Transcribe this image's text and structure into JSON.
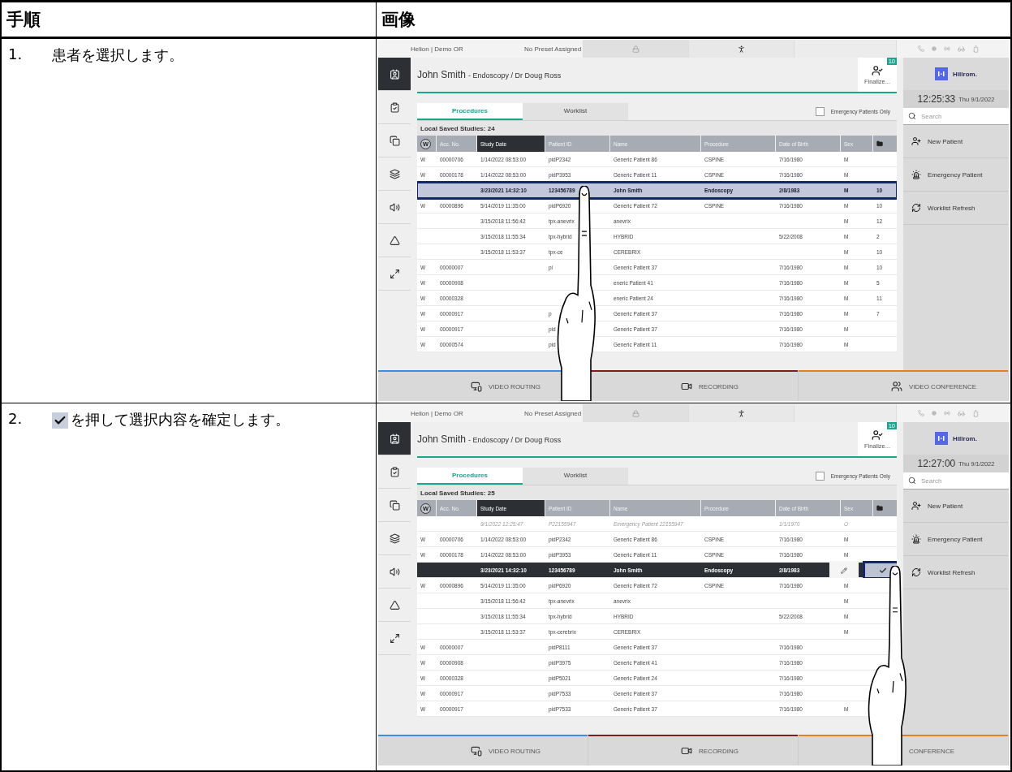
{
  "table_header": {
    "step": "手順",
    "image": "画像"
  },
  "steps": [
    {
      "number": "1.",
      "text": "患者を選択します。",
      "inline_icon": false,
      "screen": {
        "top_bar": {
          "location": "Helion | Demo OR",
          "preset": "No Preset Assigned"
        },
        "rail": [
          {
            "selected": true
          },
          {
            "selected": false
          },
          {
            "selected": false
          },
          {
            "selected": false
          },
          {
            "selected": false
          },
          {
            "selected": false
          },
          {
            "selected": false
          }
        ],
        "header": {
          "patient": "John Smith",
          "details": "- Endoscopy / Dr Doug Ross",
          "finalize_label": "Finalize...",
          "finalize_badge": "10"
        },
        "tabs": [
          {
            "label": "Procedures",
            "selected": true
          },
          {
            "label": "Worklist",
            "selected": false
          }
        ],
        "emergency_filter": {
          "label": "Emergency Patients Only",
          "checked": false
        },
        "saved_studies": "Local Saved Studies: 24",
        "columns": [
          {
            "kind": "circle",
            "label": "W",
            "selected": false
          },
          {
            "kind": "text",
            "label": "Acc. No.",
            "selected": false
          },
          {
            "kind": "text",
            "label": "Study Date",
            "selected": true
          },
          {
            "kind": "text",
            "label": "Patient ID",
            "selected": false
          },
          {
            "kind": "text",
            "label": "Name",
            "selected": false
          },
          {
            "kind": "text",
            "label": "Procedure",
            "selected": false
          },
          {
            "kind": "text",
            "label": "Date of Birth",
            "selected": false
          },
          {
            "kind": "text",
            "label": "Sex",
            "selected": false
          },
          {
            "kind": "icon",
            "selected": false
          }
        ],
        "rows": [
          {
            "kind": "normal",
            "selected": false,
            "w": "W",
            "acc_no": "00000706",
            "study_date": "1/14/2022 08:53:00",
            "patient_id": "pidP2342",
            "name": "Generic Patient 86",
            "procedure": "CSPINE",
            "date_of_birth": "7/16/1980",
            "sex": "M"
          },
          {
            "kind": "normal",
            "selected": false,
            "w": "W",
            "acc_no": "00000178",
            "study_date": "1/14/2022 08:53:00",
            "patient_id": "pidP3953",
            "name": "Generic Patient 11",
            "procedure": "CSPINE",
            "date_of_birth": "7/16/1980",
            "sex": "M"
          },
          {
            "kind": "normal",
            "selected": true,
            "study_date": "3/23/2021 14:32:10",
            "patient_id": "123456789",
            "name": "John Smith",
            "procedure": "Endoscopy",
            "date_of_birth": "2/8/1983",
            "sex": "M",
            "count": "10"
          },
          {
            "kind": "normal",
            "selected": false,
            "w": "W",
            "acc_no": "00000896",
            "study_date": "5/14/2019 11:35:00",
            "patient_id": "pidP6920",
            "name": "Generic Patient 72",
            "procedure": "CSPINE",
            "date_of_birth": "7/16/1980",
            "sex": "M",
            "count": "10"
          },
          {
            "kind": "normal",
            "selected": false,
            "study_date": "3/15/2018 11:56:42",
            "patient_id": "tpx-anevrix",
            "name": "anevrix",
            "sex": "M",
            "count": "12"
          },
          {
            "kind": "normal",
            "selected": false,
            "study_date": "3/15/2018 11:55:34",
            "patient_id": "tpx-hybrid",
            "name": "HYBRID",
            "date_of_birth": "5/22/2008",
            "sex": "M",
            "count": "2"
          },
          {
            "kind": "normal",
            "selected": false,
            "study_date": "3/15/2018 11:53:37",
            "patient_id": "tpx-ce",
            "name": "CEREBRIX",
            "sex": "M",
            "count": "10"
          },
          {
            "kind": "normal",
            "selected": false,
            "w": "W",
            "acc_no": "00000007",
            "patient_id": "pi",
            "name": "Generic Patient 37",
            "date_of_birth": "7/16/1980",
            "sex": "M",
            "count": "10"
          },
          {
            "kind": "normal",
            "selected": false,
            "w": "W",
            "acc_no": "00000908",
            "name": "eneric Patient 41",
            "date_of_birth": "7/16/1980",
            "sex": "M",
            "count": "5"
          },
          {
            "kind": "normal",
            "selected": false,
            "w": "W",
            "acc_no": "00000328",
            "name": "eneric Patient 24",
            "date_of_birth": "7/16/1980",
            "sex": "M",
            "count": "11"
          },
          {
            "kind": "normal",
            "selected": false,
            "w": "W",
            "acc_no": "00000917",
            "patient_id": "p",
            "name": "Generic Patient 37",
            "date_of_birth": "7/16/1980",
            "sex": "M",
            "count": "7"
          },
          {
            "kind": "normal",
            "selected": false,
            "w": "W",
            "acc_no": "00000917",
            "patient_id": "pid",
            "name": "Generic Patient 37",
            "date_of_birth": "7/16/1980",
            "sex": "M"
          },
          {
            "kind": "normal",
            "selected": false,
            "w": "W",
            "acc_no": "00000574",
            "patient_id": "pid",
            "name": "Generic Patient 11",
            "date_of_birth": "7/16/1980",
            "sex": "M"
          }
        ],
        "brand": "Hillrom.",
        "time": "12:25:33",
        "date": "Thu 9/1/2022",
        "search_placeholder": "Search",
        "side_buttons": [
          "New Patient",
          "Emergency Patient",
          "Worklist Refresh"
        ],
        "bottom_bar": [
          {
            "label": "VIDEO ROUTING",
            "color": "#3a8ee6",
            "icon_visible": true
          },
          {
            "label": "RECORDING",
            "color": "#7a1e1e",
            "icon_visible": true
          },
          {
            "label": "VIDEO CONFERENCE",
            "color": "#e3801f",
            "icon_visible": true
          }
        ]
      }
    },
    {
      "number": "2.",
      "text": "を押して選択内容を確定します。",
      "inline_icon": true,
      "screen": {
        "top_bar": {
          "location": "Helion | Demo OR",
          "preset": "No Preset Assigned"
        },
        "rail": [
          {
            "selected": true
          },
          {
            "selected": false
          },
          {
            "selected": false
          },
          {
            "selected": false
          },
          {
            "selected": false
          },
          {
            "selected": false
          },
          {
            "selected": false
          }
        ],
        "header": {
          "patient": "John Smith",
          "details": "- Endoscopy / Dr Doug Ross",
          "finalize_label": "Finalize...",
          "finalize_badge": "10"
        },
        "tabs": [
          {
            "label": "Procedures",
            "selected": true
          },
          {
            "label": "Worklist",
            "selected": false
          }
        ],
        "emergency_filter": {
          "label": "Emergency Patients Only",
          "checked": false
        },
        "saved_studies": "Local Saved Studies: 25",
        "columns": [
          {
            "kind": "circle",
            "label": "W",
            "selected": false
          },
          {
            "kind": "text",
            "label": "Acc. No.",
            "selected": false
          },
          {
            "kind": "text",
            "label": "Study Date",
            "selected": true
          },
          {
            "kind": "text",
            "label": "Patient ID",
            "selected": false
          },
          {
            "kind": "text",
            "label": "Name",
            "selected": false
          },
          {
            "kind": "text",
            "label": "Procedure",
            "selected": false
          },
          {
            "kind": "text",
            "label": "Date of Birth",
            "selected": false
          },
          {
            "kind": "text",
            "label": "Sex",
            "selected": false
          },
          {
            "kind": "icon",
            "selected": false
          }
        ],
        "rows": [
          {
            "kind": "emergency",
            "selected": false,
            "study_date": "9/1/2022 12:25:47",
            "patient_id": "P22155947",
            "name": "Emergency Patient 22155947",
            "date_of_birth": "1/1/1970",
            "sex": "O"
          },
          {
            "kind": "normal",
            "selected": false,
            "w": "W",
            "acc_no": "00000706",
            "study_date": "1/14/2022 08:53:00",
            "patient_id": "pidP2342",
            "name": "Generic Patient 86",
            "procedure": "CSPINE",
            "date_of_birth": "7/16/1980",
            "sex": "M"
          },
          {
            "kind": "normal",
            "selected": false,
            "w": "W",
            "acc_no": "00000178",
            "study_date": "1/14/2022 08:53:00",
            "patient_id": "pidP3953",
            "name": "Generic Patient 11",
            "procedure": "CSPINE",
            "date_of_birth": "7/16/1980",
            "sex": "M"
          },
          {
            "kind": "normal",
            "selected": true,
            "study_date": "3/23/2021 14:32:10",
            "patient_id": "123456789",
            "name": "John Smith",
            "procedure": "Endoscopy",
            "date_of_birth": "2/8/1983"
          },
          {
            "kind": "normal",
            "selected": false,
            "w": "W",
            "acc_no": "00000896",
            "study_date": "5/14/2019 11:35:00",
            "patient_id": "pidP6920",
            "name": "Generic Patient 72",
            "procedure": "CSPINE",
            "date_of_birth": "7/16/1980",
            "sex": "M"
          },
          {
            "kind": "normal",
            "selected": false,
            "study_date": "3/15/2018 11:56:42",
            "patient_id": "tpx-anevrix",
            "name": "anevrix",
            "sex": "M"
          },
          {
            "kind": "normal",
            "selected": false,
            "study_date": "3/15/2018 11:55:34",
            "patient_id": "tpx-hybrid",
            "name": "HYBRID",
            "date_of_birth": "5/22/2008",
            "sex": "M"
          },
          {
            "kind": "normal",
            "selected": false,
            "study_date": "3/15/2018 11:53:37",
            "patient_id": "tpx-cerebrix",
            "name": "CEREBRIX",
            "sex": "M"
          },
          {
            "kind": "normal",
            "selected": false,
            "w": "W",
            "acc_no": "00000007",
            "patient_id": "pidP8111",
            "name": "Generic Patient 37",
            "date_of_birth": "7/16/1980"
          },
          {
            "kind": "normal",
            "selected": false,
            "w": "W",
            "acc_no": "00000908",
            "patient_id": "pidP3975",
            "name": "Generic Patient 41",
            "date_of_birth": "7/16/1980"
          },
          {
            "kind": "normal",
            "selected": false,
            "w": "W",
            "acc_no": "00000328",
            "patient_id": "pidP5021",
            "name": "Generic Patient 24",
            "date_of_birth": "7/16/1980"
          },
          {
            "kind": "normal",
            "selected": false,
            "w": "W",
            "acc_no": "00000917",
            "patient_id": "pidP7533",
            "name": "Generic Patient 37",
            "date_of_birth": "7/16/1980"
          },
          {
            "kind": "normal",
            "selected": false,
            "w": "W",
            "acc_no": "00000917",
            "patient_id": "pidP7533",
            "name": "Generic Patient 37",
            "date_of_birth": "7/16/1980",
            "sex": "M"
          }
        ],
        "row_actions": [
          {
            "kind": "edit",
            "highlighted": false
          },
          {
            "kind": "confirm",
            "highlighted": true
          }
        ],
        "brand": "Hillrom.",
        "time": "12:27:00",
        "date": "Thu 9/1/2022",
        "search_placeholder": "Search",
        "side_buttons": [
          "New Patient",
          "Emergency Patient",
          "Worklist Refresh"
        ],
        "bottom_bar": [
          {
            "label": "VIDEO ROUTING",
            "color": "#3a8ee6",
            "icon_visible": true
          },
          {
            "label": "RECORDING",
            "color": "#7a1e1e",
            "icon_visible": true
          },
          {
            "label": "CONFERENCE",
            "color": "#e3801f",
            "icon_visible": false
          }
        ]
      }
    }
  ]
}
